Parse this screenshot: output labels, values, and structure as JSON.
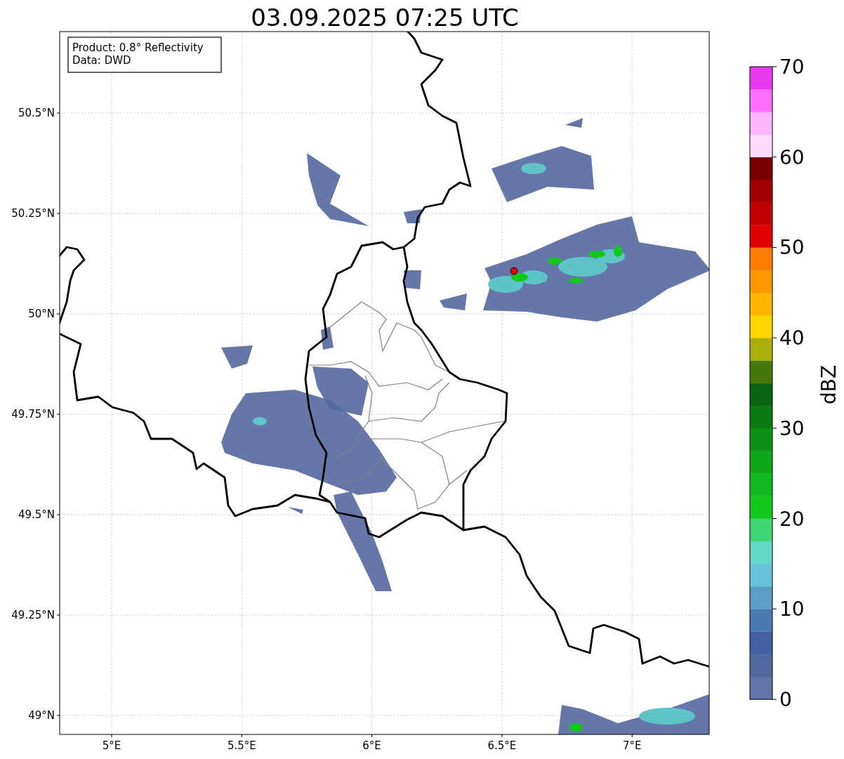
{
  "title": "03.09.2025 07:25 UTC",
  "info_box": {
    "lines": [
      "Product: 0.8° Reflectivity",
      "Data: DWD"
    ]
  },
  "map": {
    "x_ticks": [
      "5°E",
      "5.5°E",
      "6°E",
      "6.5°E",
      "7°E"
    ],
    "y_ticks": [
      "50.5°N",
      "50.25°N",
      "50°N",
      "49.75°N",
      "49.5°N",
      "49.25°N",
      "49°N"
    ]
  },
  "colorbar": {
    "label": "dBZ",
    "ticks": [
      "70",
      "60",
      "50",
      "40",
      "30",
      "20",
      "10",
      "0"
    ],
    "bins": [
      {
        "color": "#6375a8"
      },
      {
        "color": "#5468a0"
      },
      {
        "color": "#4360a5"
      },
      {
        "color": "#4a7ab0"
      },
      {
        "color": "#5a9ec6"
      },
      {
        "color": "#68c2dc"
      },
      {
        "color": "#63d8c8"
      },
      {
        "color": "#3dd672"
      },
      {
        "color": "#12c81a"
      },
      {
        "color": "#10b820"
      },
      {
        "color": "#10a818"
      },
      {
        "color": "#0e9216"
      },
      {
        "color": "#0c7c12"
      },
      {
        "color": "#0a6410"
      },
      {
        "color": "#46780c"
      },
      {
        "color": "#aab008"
      },
      {
        "color": "#ffd600"
      },
      {
        "color": "#ffb400"
      },
      {
        "color": "#ff9800"
      },
      {
        "color": "#ff7c00"
      },
      {
        "color": "#e00000"
      },
      {
        "color": "#c00000"
      },
      {
        "color": "#a00000"
      },
      {
        "color": "#780000"
      },
      {
        "color": "#ffdcff"
      },
      {
        "color": "#ffb4ff"
      },
      {
        "color": "#ff6eff"
      },
      {
        "color": "#e838f0"
      }
    ]
  }
}
